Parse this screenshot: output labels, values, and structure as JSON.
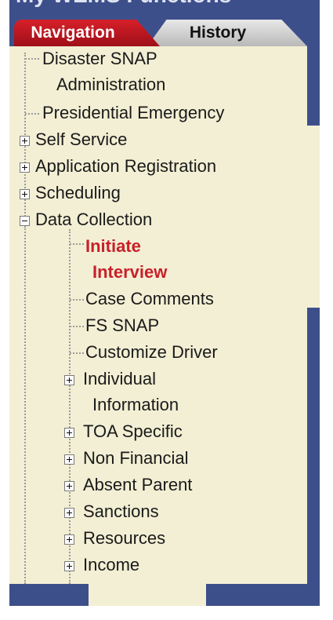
{
  "header": {
    "title": "My WEMS Functions"
  },
  "tabs": [
    {
      "label": "Navigation",
      "selected": true
    },
    {
      "label": "History",
      "selected": false
    }
  ],
  "tree": {
    "top": [
      {
        "label_lines": [
          "Disaster SNAP",
          "Administration"
        ]
      },
      {
        "label": "Presidential Emergency"
      },
      {
        "label": "Self Service",
        "expander": "plus"
      },
      {
        "label": "Application Registration",
        "expander": "plus"
      },
      {
        "label": "Scheduling",
        "expander": "plus"
      },
      {
        "label": "Data Collection",
        "expander": "minus"
      }
    ],
    "data_collection_children": [
      {
        "label_lines": [
          "Initiate",
          "Interview"
        ],
        "active": true
      },
      {
        "label": "Case Comments"
      },
      {
        "label": "FS SNAP"
      },
      {
        "label": "Customize Driver"
      },
      {
        "label_lines": [
          "Individual",
          "Information"
        ],
        "expander": "plus"
      },
      {
        "label": "TOA Specific",
        "expander": "plus"
      },
      {
        "label": "Non Financial",
        "expander": "plus"
      },
      {
        "label": "Absent Parent",
        "expander": "plus"
      },
      {
        "label": "Sanctions",
        "expander": "plus"
      },
      {
        "label": "Resources",
        "expander": "plus"
      },
      {
        "label": "Income",
        "expander": "plus"
      }
    ]
  },
  "colors": {
    "frame": "#3d4f8a",
    "panel": "#f2efd4",
    "active_tab": "#c8202a",
    "active_item": "#c8202a"
  }
}
